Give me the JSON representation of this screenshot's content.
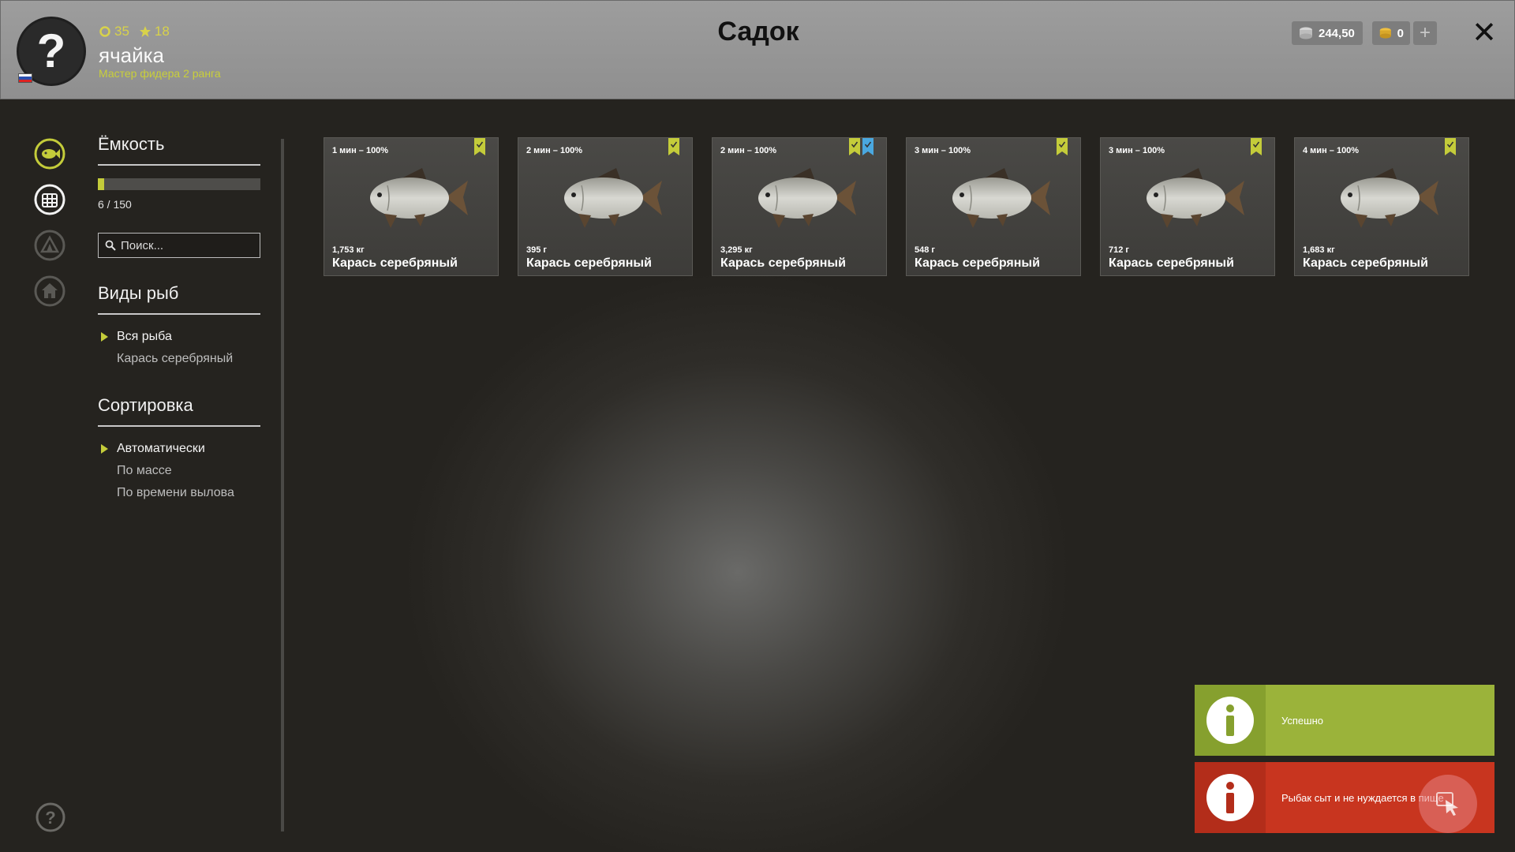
{
  "header": {
    "title": "Садок",
    "player": {
      "avatar_glyph": "?",
      "level": "35",
      "stars": "18",
      "name": "ячайка",
      "rank": "Мастер фидера 2 ранга"
    },
    "currency": {
      "silver": "244,50",
      "gold": "0",
      "add_label": "+"
    },
    "close_label": "✕"
  },
  "nav_icons": [
    "fish-icon",
    "keepnet-icon",
    "camp-icon",
    "home-icon"
  ],
  "sidebar": {
    "capacity": {
      "title": "Ёмкость",
      "current": 6,
      "max": 150,
      "text": "6 / 150"
    },
    "search": {
      "placeholder": "Поиск..."
    },
    "species": {
      "title": "Виды рыб",
      "items": [
        {
          "label": "Вся рыба",
          "active": true
        },
        {
          "label": "Карась серебряный",
          "active": false
        }
      ]
    },
    "sorting": {
      "title": "Сортировка",
      "items": [
        {
          "label": "Автоматически",
          "active": true
        },
        {
          "label": "По массе",
          "active": false
        },
        {
          "label": "По времени вылова",
          "active": false
        }
      ]
    }
  },
  "fish": [
    {
      "time": "1 мин – 100%",
      "weight": "1,753 кг",
      "name": "Карась серебряный",
      "badges": [
        "green"
      ]
    },
    {
      "time": "2 мин – 100%",
      "weight": "395 г",
      "name": "Карась серебряный",
      "badges": [
        "green"
      ]
    },
    {
      "time": "2 мин – 100%",
      "weight": "3,295 кг",
      "name": "Карась серебряный",
      "badges": [
        "green",
        "blue"
      ]
    },
    {
      "time": "3 мин – 100%",
      "weight": "548 г",
      "name": "Карась серебряный",
      "badges": [
        "green"
      ]
    },
    {
      "time": "3 мин – 100%",
      "weight": "712 г",
      "name": "Карась серебряный",
      "badges": [
        "green"
      ]
    },
    {
      "time": "4 мин – 100%",
      "weight": "1,683 кг",
      "name": "Карась серебряный",
      "badges": [
        "green"
      ]
    }
  ],
  "notifications": {
    "success": "Успешно",
    "error": "Рыбак сыт и не нуждается в пище"
  },
  "colors": {
    "accent": "#c4cc3a",
    "badge_green": "#c4cc3a",
    "badge_blue": "#4aa8e0",
    "success": "#9bb33a",
    "error": "#c8351f"
  }
}
